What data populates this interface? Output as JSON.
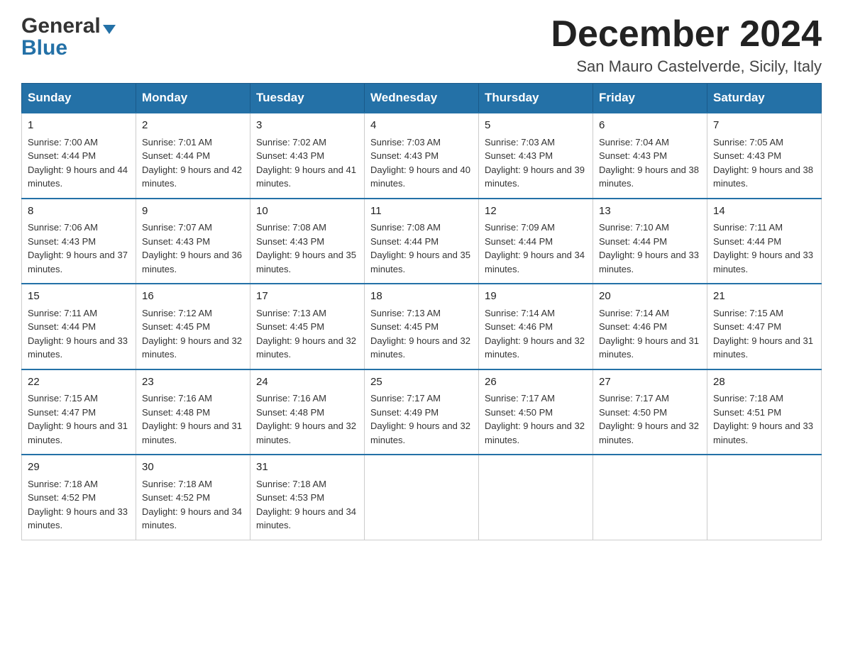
{
  "header": {
    "logo_line1": "General",
    "logo_line2": "Blue",
    "month_title": "December 2024",
    "location": "San Mauro Castelverde, Sicily, Italy"
  },
  "weekdays": [
    "Sunday",
    "Monday",
    "Tuesday",
    "Wednesday",
    "Thursday",
    "Friday",
    "Saturday"
  ],
  "weeks": [
    [
      {
        "day": "1",
        "sunrise": "7:00 AM",
        "sunset": "4:44 PM",
        "daylight": "9 hours and 44 minutes."
      },
      {
        "day": "2",
        "sunrise": "7:01 AM",
        "sunset": "4:44 PM",
        "daylight": "9 hours and 42 minutes."
      },
      {
        "day": "3",
        "sunrise": "7:02 AM",
        "sunset": "4:43 PM",
        "daylight": "9 hours and 41 minutes."
      },
      {
        "day": "4",
        "sunrise": "7:03 AM",
        "sunset": "4:43 PM",
        "daylight": "9 hours and 40 minutes."
      },
      {
        "day": "5",
        "sunrise": "7:03 AM",
        "sunset": "4:43 PM",
        "daylight": "9 hours and 39 minutes."
      },
      {
        "day": "6",
        "sunrise": "7:04 AM",
        "sunset": "4:43 PM",
        "daylight": "9 hours and 38 minutes."
      },
      {
        "day": "7",
        "sunrise": "7:05 AM",
        "sunset": "4:43 PM",
        "daylight": "9 hours and 38 minutes."
      }
    ],
    [
      {
        "day": "8",
        "sunrise": "7:06 AM",
        "sunset": "4:43 PM",
        "daylight": "9 hours and 37 minutes."
      },
      {
        "day": "9",
        "sunrise": "7:07 AM",
        "sunset": "4:43 PM",
        "daylight": "9 hours and 36 minutes."
      },
      {
        "day": "10",
        "sunrise": "7:08 AM",
        "sunset": "4:43 PM",
        "daylight": "9 hours and 35 minutes."
      },
      {
        "day": "11",
        "sunrise": "7:08 AM",
        "sunset": "4:44 PM",
        "daylight": "9 hours and 35 minutes."
      },
      {
        "day": "12",
        "sunrise": "7:09 AM",
        "sunset": "4:44 PM",
        "daylight": "9 hours and 34 minutes."
      },
      {
        "day": "13",
        "sunrise": "7:10 AM",
        "sunset": "4:44 PM",
        "daylight": "9 hours and 33 minutes."
      },
      {
        "day": "14",
        "sunrise": "7:11 AM",
        "sunset": "4:44 PM",
        "daylight": "9 hours and 33 minutes."
      }
    ],
    [
      {
        "day": "15",
        "sunrise": "7:11 AM",
        "sunset": "4:44 PM",
        "daylight": "9 hours and 33 minutes."
      },
      {
        "day": "16",
        "sunrise": "7:12 AM",
        "sunset": "4:45 PM",
        "daylight": "9 hours and 32 minutes."
      },
      {
        "day": "17",
        "sunrise": "7:13 AM",
        "sunset": "4:45 PM",
        "daylight": "9 hours and 32 minutes."
      },
      {
        "day": "18",
        "sunrise": "7:13 AM",
        "sunset": "4:45 PM",
        "daylight": "9 hours and 32 minutes."
      },
      {
        "day": "19",
        "sunrise": "7:14 AM",
        "sunset": "4:46 PM",
        "daylight": "9 hours and 32 minutes."
      },
      {
        "day": "20",
        "sunrise": "7:14 AM",
        "sunset": "4:46 PM",
        "daylight": "9 hours and 31 minutes."
      },
      {
        "day": "21",
        "sunrise": "7:15 AM",
        "sunset": "4:47 PM",
        "daylight": "9 hours and 31 minutes."
      }
    ],
    [
      {
        "day": "22",
        "sunrise": "7:15 AM",
        "sunset": "4:47 PM",
        "daylight": "9 hours and 31 minutes."
      },
      {
        "day": "23",
        "sunrise": "7:16 AM",
        "sunset": "4:48 PM",
        "daylight": "9 hours and 31 minutes."
      },
      {
        "day": "24",
        "sunrise": "7:16 AM",
        "sunset": "4:48 PM",
        "daylight": "9 hours and 32 minutes."
      },
      {
        "day": "25",
        "sunrise": "7:17 AM",
        "sunset": "4:49 PM",
        "daylight": "9 hours and 32 minutes."
      },
      {
        "day": "26",
        "sunrise": "7:17 AM",
        "sunset": "4:50 PM",
        "daylight": "9 hours and 32 minutes."
      },
      {
        "day": "27",
        "sunrise": "7:17 AM",
        "sunset": "4:50 PM",
        "daylight": "9 hours and 32 minutes."
      },
      {
        "day": "28",
        "sunrise": "7:18 AM",
        "sunset": "4:51 PM",
        "daylight": "9 hours and 33 minutes."
      }
    ],
    [
      {
        "day": "29",
        "sunrise": "7:18 AM",
        "sunset": "4:52 PM",
        "daylight": "9 hours and 33 minutes."
      },
      {
        "day": "30",
        "sunrise": "7:18 AM",
        "sunset": "4:52 PM",
        "daylight": "9 hours and 34 minutes."
      },
      {
        "day": "31",
        "sunrise": "7:18 AM",
        "sunset": "4:53 PM",
        "daylight": "9 hours and 34 minutes."
      },
      null,
      null,
      null,
      null
    ]
  ],
  "labels": {
    "sunrise_prefix": "Sunrise: ",
    "sunset_prefix": "Sunset: ",
    "daylight_prefix": "Daylight: "
  }
}
